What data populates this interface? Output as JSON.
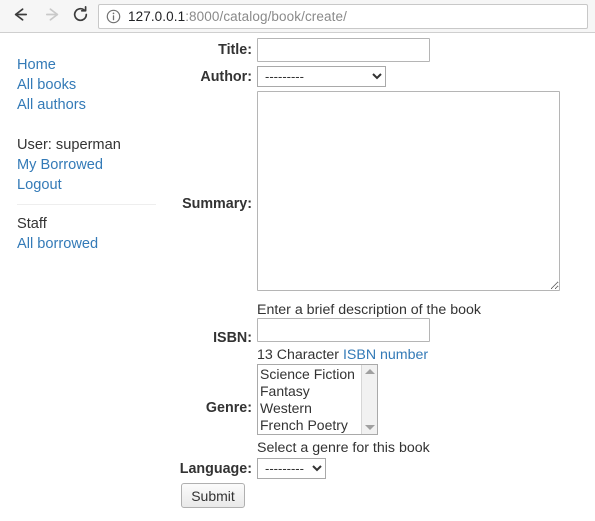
{
  "browser": {
    "back_icon": "back-arrow-icon",
    "forward_icon": "forward-arrow-icon",
    "reload_icon": "reload-icon",
    "info_icon": "info-circle-icon",
    "url_host": "127.0.0.1",
    "url_path": ":8000/catalog/book/create/",
    "url_full": "127.0.0.1:8000/catalog/book/create/"
  },
  "sidebar": {
    "links_primary": [
      {
        "label": "Home"
      },
      {
        "label": "All books"
      },
      {
        "label": "All authors"
      }
    ],
    "user_line": "User: superman",
    "links_user": [
      {
        "label": "My Borrowed"
      },
      {
        "label": "Logout"
      }
    ],
    "staff_heading": "Staff",
    "links_staff": [
      {
        "label": "All borrowed"
      }
    ]
  },
  "form": {
    "title": {
      "label": "Title:",
      "value": "",
      "placeholder": ""
    },
    "author": {
      "label": "Author:",
      "selected": "---------",
      "options": [
        "---------"
      ]
    },
    "summary": {
      "label": "Summary:",
      "value": "",
      "placeholder": "",
      "help": "Enter a brief description of the book"
    },
    "isbn": {
      "label": "ISBN:",
      "value": "",
      "placeholder": "",
      "help_prefix": "13 Character ",
      "help_link": "ISBN number"
    },
    "genre": {
      "label": "Genre:",
      "options": [
        "Science Fiction",
        "Fantasy",
        "Western",
        "French Poetry"
      ],
      "help": "Select a genre for this book"
    },
    "language": {
      "label": "Language:",
      "selected": "---------",
      "options": [
        "---------"
      ]
    },
    "submit_label": "Submit"
  },
  "colors": {
    "link": "#337ab7",
    "text": "#333333",
    "chrome_bg": "#f6f6f6",
    "field_border": "#b5b5b5"
  }
}
